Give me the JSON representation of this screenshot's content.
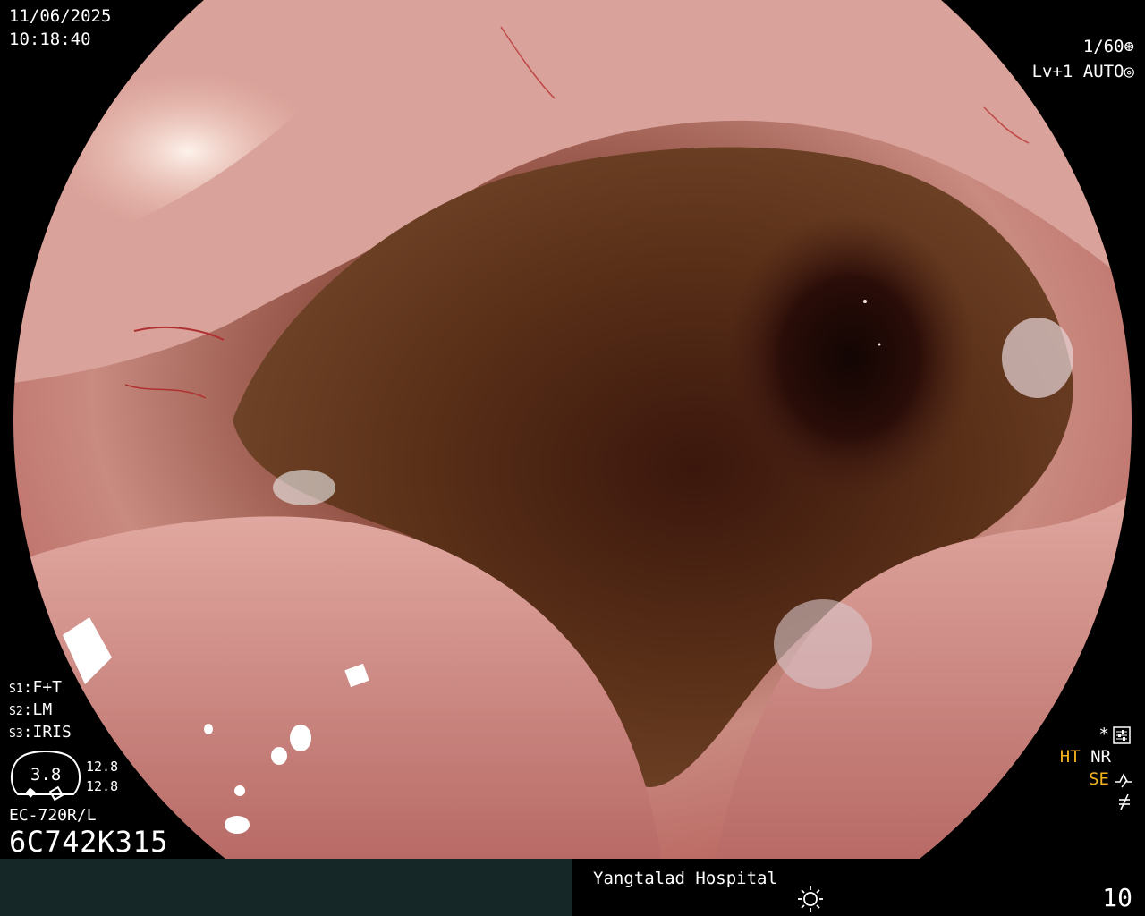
{
  "datetime": {
    "date": "11/06/2025",
    "time": "10:18:40"
  },
  "camera": {
    "shutter": "1/60",
    "level": "Lv+1",
    "mode": "AUTO"
  },
  "settings": {
    "s1_key": "S1",
    "s1_val": "F+T",
    "s2_key": "S2",
    "s2_val": "LM",
    "s3_key": "S3",
    "s3_val": "IRIS"
  },
  "gauge": {
    "value": "3.8",
    "top": "12.8",
    "bottom": "12.8"
  },
  "scope": {
    "model": "EC-720R/L",
    "serial": "6C742K315"
  },
  "indicators": {
    "asterisk": "*",
    "ht": "HT",
    "nr": "NR",
    "se": "SE"
  },
  "footer": {
    "hospital": "Yangtalad Hospital",
    "number": "10"
  },
  "icons": [
    "shutter-icon",
    "auto-iris-icon",
    "menu-settings-icon",
    "enhance-curve-icon",
    "freeze-icon",
    "light-icon"
  ]
}
